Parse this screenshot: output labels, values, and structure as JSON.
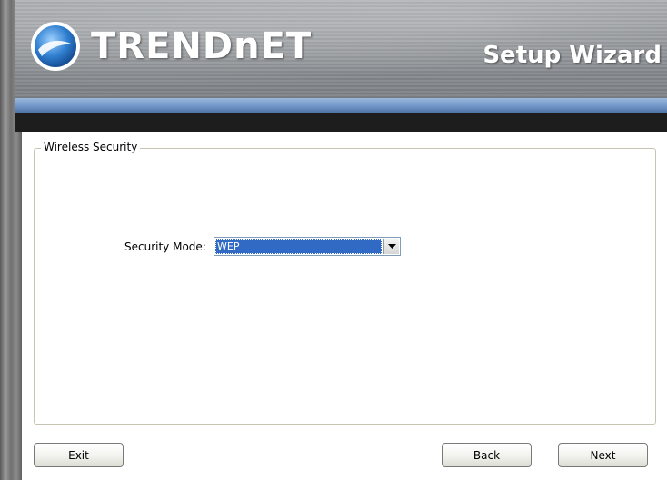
{
  "header": {
    "brand": "TRENDnET",
    "title": "Setup Wizard"
  },
  "section": {
    "legend": "Wireless Security",
    "security_mode_label": "Security Mode:",
    "security_mode_value": "WEP"
  },
  "buttons": {
    "exit": "Exit",
    "back": "Back",
    "next": "Next"
  },
  "colors": {
    "selection": "#316ac5",
    "stripe": "#6f94c6"
  }
}
